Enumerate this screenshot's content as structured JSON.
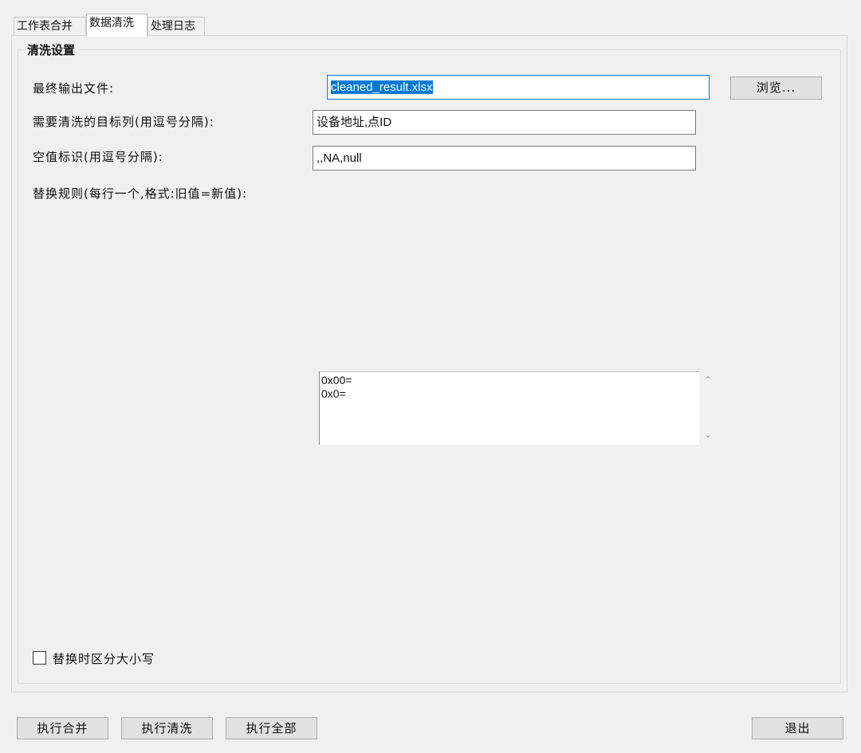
{
  "tabs": [
    {
      "label": "工作表合并"
    },
    {
      "label": "数据清洗"
    },
    {
      "label": "处理日志"
    }
  ],
  "group": {
    "title": "清洗设置"
  },
  "form": {
    "output_label": "最终输出文件:",
    "output_value": "cleaned_result.xlsx",
    "browse_label": "浏览...",
    "target_label": "需要清洗的目标列(用逗号分隔):",
    "target_value": "设备地址,点ID",
    "null_label": "空值标识(用逗号分隔):",
    "null_value": ",,NA,null",
    "rules_label": "替换规则(每行一个,格式:旧值=新值):",
    "rules_lines": [
      "0x00=",
      "0x0="
    ],
    "case_label": "替换时区分大小写",
    "case_checked": false
  },
  "footer": {
    "merge_button": "执行合并",
    "clean_button": "执行清洗",
    "all_button": "执行全部",
    "exit_button": "退出"
  },
  "icons": {
    "scroll_up": "chevron-up-icon",
    "scroll_down": "chevron-down-icon"
  },
  "colors": {
    "selection": "#0078d7",
    "focus_border": "#0078d7"
  }
}
